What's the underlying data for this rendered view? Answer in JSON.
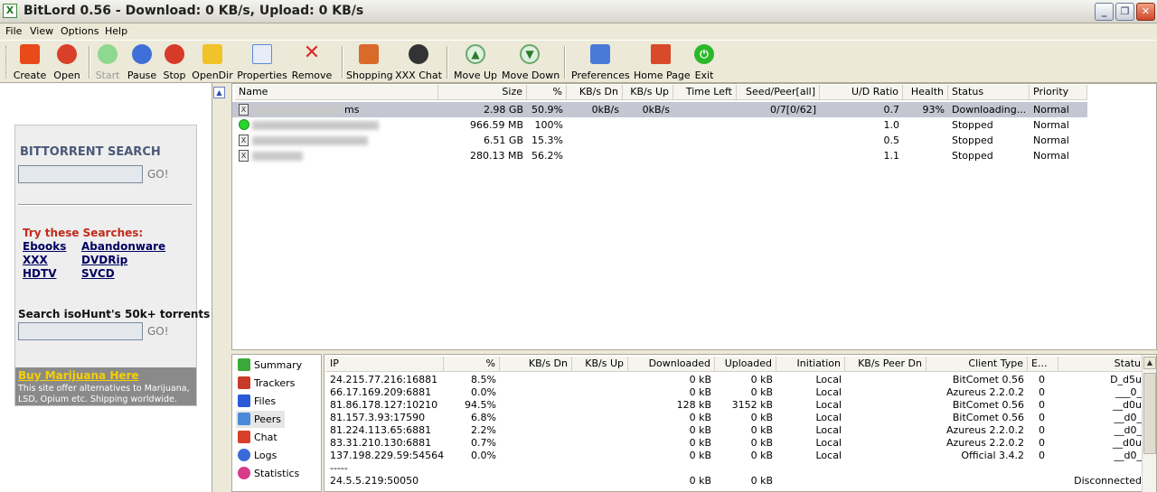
{
  "window": {
    "title": "BitLord 0.56 - Download: 0 KB/s, Upload: 0 KB/s",
    "icon_label": "X"
  },
  "menu": [
    "File",
    "View",
    "Options",
    "Help"
  ],
  "toolbar": [
    {
      "label": "Create",
      "icon": "create-icon",
      "color": "#e84a1a"
    },
    {
      "label": "Open",
      "icon": "open-icon",
      "color": "#d8402a"
    },
    {
      "label": "Start",
      "icon": "play-icon",
      "color": "#3fbf3f",
      "disabled": true
    },
    {
      "label": "Pause",
      "icon": "pause-icon",
      "color": "#3f6fd8"
    },
    {
      "label": "Stop",
      "icon": "stop-icon",
      "color": "#d83a2a"
    },
    {
      "label": "OpenDir",
      "icon": "folder-icon",
      "color": "#f2c22a"
    },
    {
      "label": "Properties",
      "icon": "properties-icon",
      "color": "#5a8ad8"
    },
    {
      "label": "Remove",
      "icon": "remove-icon",
      "color": "#d82a2a"
    },
    {
      "label": "Shopping",
      "icon": "shopping-icon",
      "color": "#d86a2a"
    },
    {
      "label": "XXX Chat",
      "icon": "chat-person-icon",
      "color": "#333333"
    },
    {
      "label": "Move Up",
      "icon": "arrow-up-icon",
      "color": "#6aa86a"
    },
    {
      "label": "Move Down",
      "icon": "arrow-down-icon",
      "color": "#6aa86a"
    },
    {
      "label": "Preferences",
      "icon": "preferences-icon",
      "color": "#4a7ad8"
    },
    {
      "label": "Home Page",
      "icon": "home-icon",
      "color": "#d84a2a"
    },
    {
      "label": "Exit",
      "icon": "power-icon",
      "color": "#2ab82a"
    }
  ],
  "search": {
    "title": "BITTORRENT SEARCH",
    "go": "GO!",
    "try_title": "Try these Searches:",
    "links": [
      "Ebooks",
      "Abandonware",
      "XXX",
      "DVDRip",
      "HDTV",
      "SVCD"
    ],
    "iso_title": "Search isoHunt's 50k+ torrents",
    "iso_go": "GO!",
    "ad_title": "Buy Marijuana Here",
    "ad_text": "This site offer alternatives to Marijuana, LSD, Opium etc. Shipping worldwide."
  },
  "torrents": {
    "columns": [
      "Name",
      "Size",
      "%",
      "KB/s Dn",
      "KB/s Up",
      "Time Left",
      "Seed/Peer[all]",
      "U/D Ratio",
      "Health",
      "Status",
      "Priority"
    ],
    "rows": [
      {
        "name_suffix": "ms",
        "size": "2.98 GB",
        "pct": "50.9%",
        "dn": "0kB/s",
        "up": "0kB/s",
        "time": "",
        "seedpeer": "0/7[0/62]",
        "ratio": "0.7",
        "health": "93%",
        "status": "Downloading...",
        "priority": "Normal"
      },
      {
        "name_suffix": "",
        "size": "966.59 MB",
        "pct": "100%",
        "dn": "",
        "up": "",
        "time": "",
        "seedpeer": "",
        "ratio": "1.0",
        "health": "",
        "status": "Stopped",
        "priority": "Normal"
      },
      {
        "name_suffix": "",
        "size": "6.51 GB",
        "pct": "15.3%",
        "dn": "",
        "up": "",
        "time": "",
        "seedpeer": "",
        "ratio": "0.5",
        "health": "",
        "status": "Stopped",
        "priority": "Normal"
      },
      {
        "name_suffix": "",
        "size": "280.13 MB",
        "pct": "56.2%",
        "dn": "",
        "up": "",
        "time": "",
        "seedpeer": "",
        "ratio": "1.1",
        "health": "",
        "status": "Stopped",
        "priority": "Normal"
      }
    ]
  },
  "nav": [
    {
      "label": "Summary",
      "icon": "summary-icon",
      "color": "#3aa83a"
    },
    {
      "label": "Trackers",
      "icon": "trackers-icon",
      "color": "#c83a2a"
    },
    {
      "label": "Files",
      "icon": "files-icon",
      "color": "#2a5ad8"
    },
    {
      "label": "Peers",
      "icon": "peers-icon",
      "color": "#4a8ad8",
      "active": true
    },
    {
      "label": "Chat",
      "icon": "chat-icon",
      "color": "#d8402a"
    },
    {
      "label": "Logs",
      "icon": "logs-icon",
      "color": "#3a6ad8"
    },
    {
      "label": "Statistics",
      "icon": "statistics-icon",
      "color": "#d83a8a"
    }
  ],
  "peers": {
    "columns": [
      "IP",
      "%",
      "KB/s Dn",
      "KB/s Up",
      "Downloaded",
      "Uploaded",
      "Initiation",
      "KB/s Peer Dn",
      "Client Type",
      "E...",
      "Statu"
    ],
    "rows": [
      {
        "ip": "24.215.77.216:16881",
        "pct": "8.5%",
        "dn": "",
        "up": "",
        "downloaded": "0 kB",
        "uploaded": "0 kB",
        "init": "Local",
        "peerdn": "",
        "client": "BitComet 0.56",
        "e": "0",
        "status": "D_d5u"
      },
      {
        "ip": "66.17.169.209:6881",
        "pct": "0.0%",
        "dn": "",
        "up": "",
        "downloaded": "0 kB",
        "uploaded": "0 kB",
        "init": "Local",
        "peerdn": "",
        "client": "Azureus 2.2.0.2",
        "e": "0",
        "status": "___0_"
      },
      {
        "ip": "81.86.178.127:10210",
        "pct": "94.5%",
        "dn": "",
        "up": "",
        "downloaded": "128 kB",
        "uploaded": "3152 kB",
        "init": "Local",
        "peerdn": "",
        "client": "BitComet 0.56",
        "e": "0",
        "status": "__d0u"
      },
      {
        "ip": "81.157.3.93:17590",
        "pct": "6.8%",
        "dn": "",
        "up": "",
        "downloaded": "0 kB",
        "uploaded": "0 kB",
        "init": "Local",
        "peerdn": "",
        "client": "BitComet 0.56",
        "e": "0",
        "status": "__d0_"
      },
      {
        "ip": "81.224.113.65:6881",
        "pct": "2.2%",
        "dn": "",
        "up": "",
        "downloaded": "0 kB",
        "uploaded": "0 kB",
        "init": "Local",
        "peerdn": "",
        "client": "Azureus 2.2.0.2",
        "e": "0",
        "status": "__d0_"
      },
      {
        "ip": "83.31.210.130:6881",
        "pct": "0.7%",
        "dn": "",
        "up": "",
        "downloaded": "0 kB",
        "uploaded": "0 kB",
        "init": "Local",
        "peerdn": "",
        "client": "Azureus 2.2.0.2",
        "e": "0",
        "status": "__d0u"
      },
      {
        "ip": "137.198.229.59:54564",
        "pct": "0.0%",
        "dn": "",
        "up": "",
        "downloaded": "0 kB",
        "uploaded": "0 kB",
        "init": "Local",
        "peerdn": "",
        "client": "Official 3.4.2",
        "e": "0",
        "status": "__d0_"
      },
      {
        "ip": "-----",
        "pct": "",
        "dn": "",
        "up": "",
        "downloaded": "",
        "uploaded": "",
        "init": "",
        "peerdn": "",
        "client": "",
        "e": "",
        "status": ""
      },
      {
        "ip": "24.5.5.219:50050",
        "pct": "",
        "dn": "",
        "up": "",
        "downloaded": "0 kB",
        "uploaded": "0 kB",
        "init": "",
        "peerdn": "",
        "client": "",
        "e": "",
        "status": "Disconnected"
      }
    ]
  }
}
